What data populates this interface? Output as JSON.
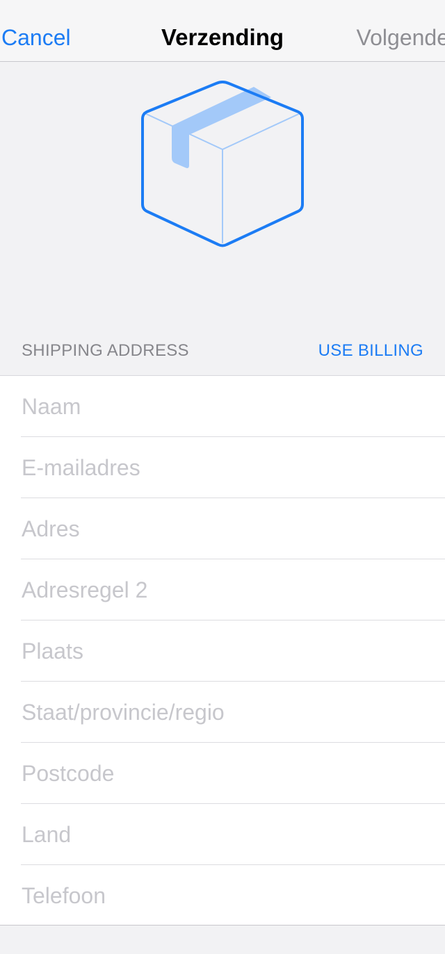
{
  "navbar": {
    "cancel_label": "Cancel",
    "title": "Verzending",
    "next_label": "Volgende"
  },
  "hero": {
    "icon": "package-box-icon",
    "accent_color": "#1c7cf4",
    "tape_color": "#a3c9f9"
  },
  "section": {
    "label": "SHIPPING ADDRESS",
    "action_label": "USE BILLING"
  },
  "form": {
    "fields": [
      {
        "placeholder": "Naam",
        "value": ""
      },
      {
        "placeholder": "E-mailadres",
        "value": ""
      },
      {
        "placeholder": "Adres",
        "value": ""
      },
      {
        "placeholder": "Adresregel 2",
        "value": ""
      },
      {
        "placeholder": "Plaats",
        "value": ""
      },
      {
        "placeholder": "Staat/provincie/regio",
        "value": ""
      },
      {
        "placeholder": "Postcode",
        "value": ""
      },
      {
        "placeholder": "Land",
        "value": ""
      },
      {
        "placeholder": "Telefoon",
        "value": ""
      }
    ]
  },
  "colors": {
    "link": "#1c7cf4",
    "disabled": "#8e8e93",
    "placeholder": "#c7c7cc",
    "background": "#f2f2f4"
  }
}
